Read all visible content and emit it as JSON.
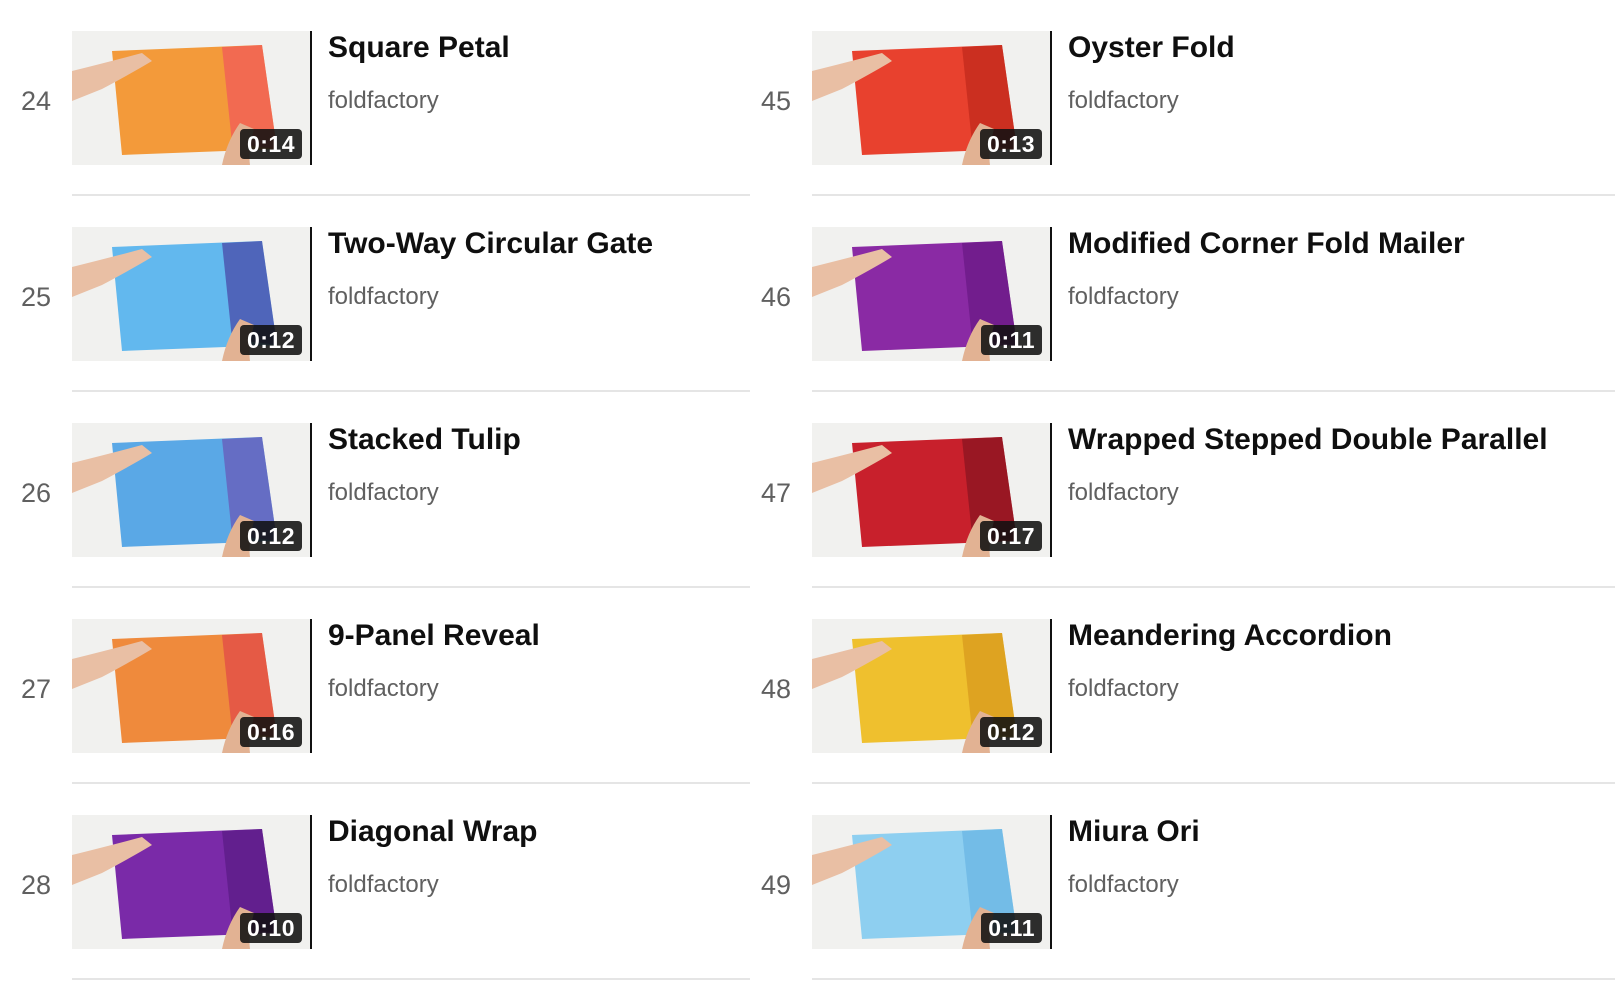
{
  "columns": [
    {
      "items": [
        {
          "index": "24",
          "title": "Square Petal",
          "channel": "foldfactory",
          "duration": "0:14",
          "paper_color": "#f39a3a",
          "accent_color": "#f15a5a"
        },
        {
          "index": "25",
          "title": "Two-Way Circular Gate",
          "channel": "foldfactory",
          "duration": "0:12",
          "paper_color": "#62b8ee",
          "accent_color": "#4a4aa8"
        },
        {
          "index": "26",
          "title": "Stacked Tulip",
          "channel": "foldfactory",
          "duration": "0:12",
          "paper_color": "#5aa8e6",
          "accent_color": "#6a5ab8"
        },
        {
          "index": "27",
          "title": "9-Panel Reveal",
          "channel": "foldfactory",
          "duration": "0:16",
          "paper_color": "#ef8a3c",
          "accent_color": "#e24a48"
        },
        {
          "index": "28",
          "title": "Diagonal Wrap",
          "channel": "foldfactory",
          "duration": "0:10",
          "paper_color": "#7a2aa8",
          "accent_color": "#5b1c86"
        }
      ]
    },
    {
      "items": [
        {
          "index": "45",
          "title": "Oyster Fold",
          "channel": "foldfactory",
          "duration": "0:13",
          "paper_color": "#e8412e",
          "accent_color": "#c22a1c"
        },
        {
          "index": "46",
          "title": "Modified Corner Fold Mailer",
          "channel": "foldfactory",
          "duration": "0:11",
          "paper_color": "#8a2aa4",
          "accent_color": "#6a1a86"
        },
        {
          "index": "47",
          "title": "Wrapped Stepped Double Parallel",
          "channel": "foldfactory",
          "duration": "0:17",
          "paper_color": "#c8202c",
          "accent_color": "#8a1420"
        },
        {
          "index": "48",
          "title": "Meandering Accordion",
          "channel": "foldfactory",
          "duration": "0:12",
          "paper_color": "#efc02e",
          "accent_color": "#d89a1e"
        },
        {
          "index": "49",
          "title": "Miura Ori",
          "channel": "foldfactory",
          "duration": "0:11",
          "paper_color": "#8ecff0",
          "accent_color": "#6ab6e4"
        }
      ]
    }
  ]
}
